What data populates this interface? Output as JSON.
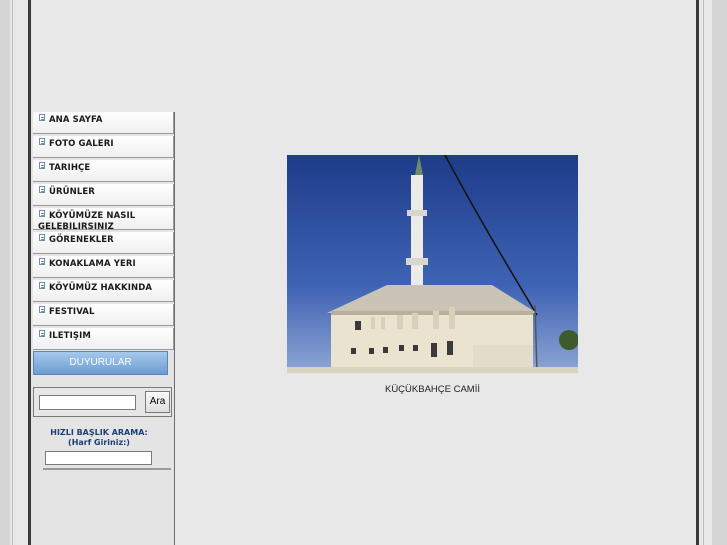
{
  "menu": {
    "items": [
      {
        "label": "ANA SAYFA"
      },
      {
        "label": "FOTO GALERI"
      },
      {
        "label": "TARIHÇE"
      },
      {
        "label": "ÜRÜNLER"
      },
      {
        "label": "KÖYÜMÜZE NASIL GELEBILIRSINIZ"
      },
      {
        "label": "GÖRENEKLER"
      },
      {
        "label": "KONAKLAMA YERI"
      },
      {
        "label": "KÖYÜMÜZ HAKKINDA"
      },
      {
        "label": "FESTIVAL"
      },
      {
        "label": "ILETIŞIM"
      }
    ]
  },
  "announcements": {
    "label": "DUYURULAR"
  },
  "search": {
    "value": "",
    "button_label": "Ara"
  },
  "quick_search": {
    "title": "HIZLI BAŞLIK ARAMA:",
    "subtitle": "(Harf Giriniz:)",
    "value": ""
  },
  "main": {
    "caption": "KÜÇÜKBAHÇE  CAMİİ"
  },
  "icons": {
    "menu_item": "document-icon"
  }
}
